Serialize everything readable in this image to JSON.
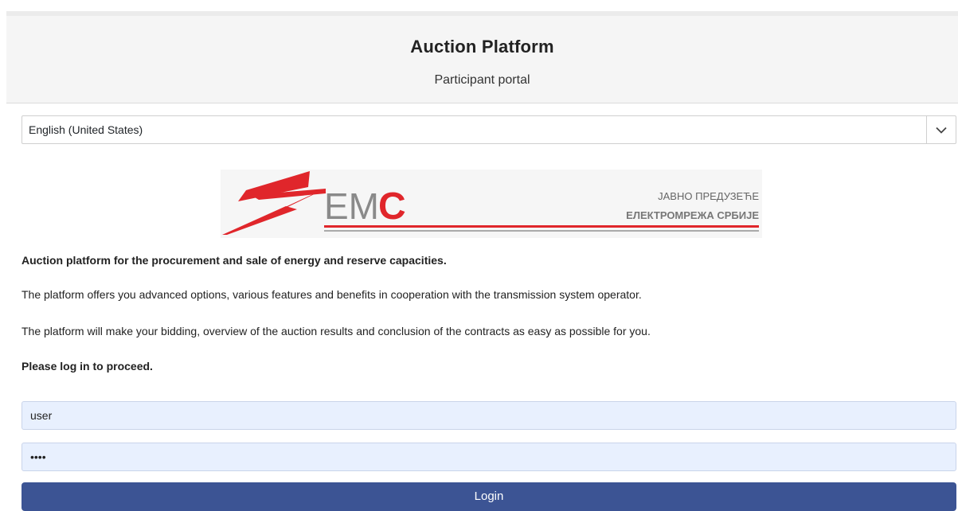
{
  "header": {
    "title": "Auction Platform",
    "subtitle": "Participant portal"
  },
  "language": {
    "selected": "English (United States)",
    "icon": "chevron-down-icon"
  },
  "logo": {
    "brand": "EMC",
    "line1": "ЈАВНО ПРЕДУЗЕЋЕ",
    "line2": "ЕЛЕКТРОМРЕЖА СРБИЈЕ",
    "colors": {
      "red": "#e0262b",
      "gray": "#8a8a8a"
    }
  },
  "content": {
    "heading": "Auction platform for the procurement and sale of energy and reserve capacities.",
    "paragraph1": "The platform offers you advanced options, various features and benefits in cooperation with the transmission system operator.",
    "paragraph2": "The platform will make your bidding, overview of the auction results and conclusion of the contracts as easy as possible for you.",
    "prompt": "Please log in to proceed."
  },
  "login": {
    "username_value": "user",
    "password_value": "1234",
    "button_label": "Login"
  },
  "colors": {
    "primary": "#3c5494",
    "autofill_bg": "#e8f0fe"
  }
}
